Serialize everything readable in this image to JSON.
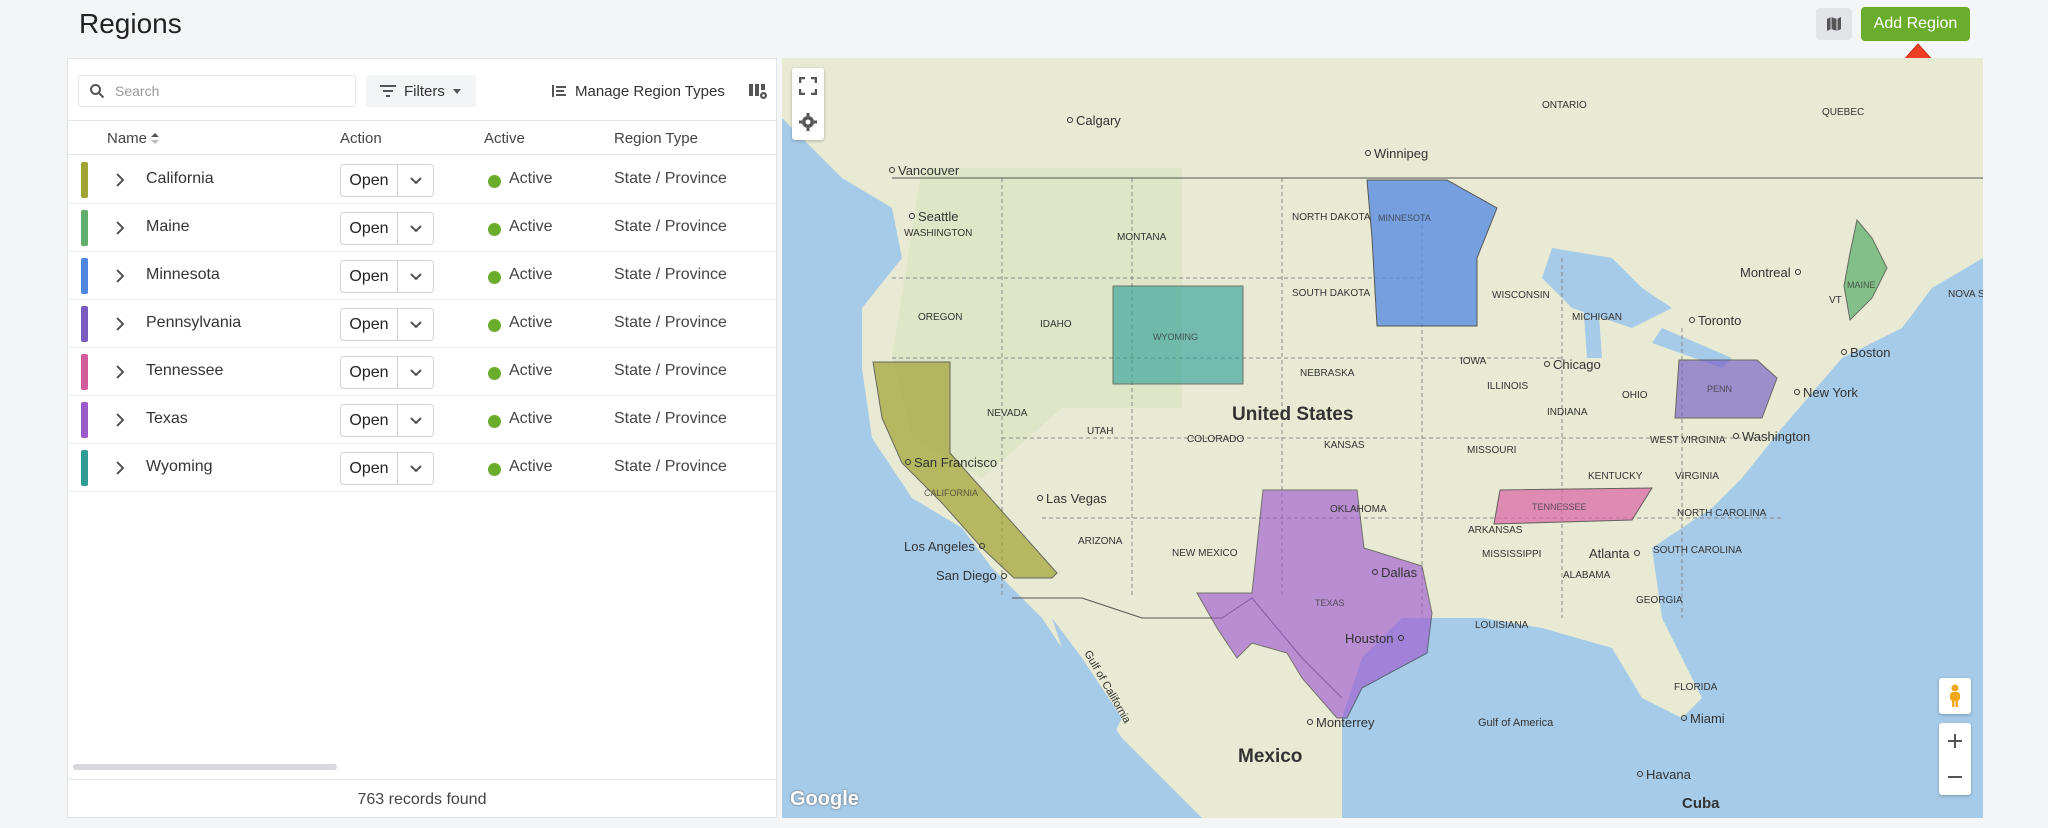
{
  "page": {
    "title": "Regions"
  },
  "header": {
    "add_region_label": "Add Region",
    "map_toggle_icon": "map-icon"
  },
  "toolbar": {
    "search_placeholder": "Search",
    "filters_label": "Filters",
    "manage_label": "Manage Region Types"
  },
  "table": {
    "columns": [
      "Name",
      "Action",
      "Active",
      "Region Type"
    ],
    "rows": [
      {
        "name": "California",
        "action": "Open",
        "active": "Active",
        "type": "State / Province",
        "color": "#9fa433"
      },
      {
        "name": "Maine",
        "action": "Open",
        "active": "Active",
        "type": "State / Province",
        "color": "#5fae6a"
      },
      {
        "name": "Minnesota",
        "action": "Open",
        "active": "Active",
        "type": "State / Province",
        "color": "#4f86e0"
      },
      {
        "name": "Pennsylvania",
        "action": "Open",
        "active": "Active",
        "type": "State / Province",
        "color": "#7a5cc1"
      },
      {
        "name": "Tennessee",
        "action": "Open",
        "active": "Active",
        "type": "State / Province",
        "color": "#d35c9c"
      },
      {
        "name": "Texas",
        "action": "Open",
        "active": "Active",
        "type": "State / Province",
        "color": "#9a5bc8"
      },
      {
        "name": "Wyoming",
        "action": "Open",
        "active": "Active",
        "type": "State / Province",
        "color": "#2f9b94"
      }
    ],
    "footer": "763 records found"
  },
  "map": {
    "country_labels": {
      "us": "United States",
      "mexico": "Mexico"
    },
    "city_labels": [
      "Calgary",
      "Winnipeg",
      "Vancouver",
      "Seattle",
      "Montreal",
      "Toronto",
      "Boston",
      "New York",
      "Chicago",
      "Washington",
      "San Francisco",
      "Las Vegas",
      "Los Angeles",
      "San Diego",
      "Dallas",
      "Houston",
      "Atlanta",
      "Monterrey",
      "Miami",
      "Havana",
      "Cuba"
    ],
    "state_labels": [
      "ONTARIO",
      "QUEBEC",
      "WASHINGTON",
      "MONTANA",
      "NORTH DAKOTA",
      "SOUTH DAKOTA",
      "OREGON",
      "IDAHO",
      "NEBRASKA",
      "IOWA",
      "WISCONSIN",
      "MICHIGAN",
      "ILLINOIS",
      "INDIANA",
      "OHIO",
      "NEVADA",
      "UTAH",
      "COLORADO",
      "KANSAS",
      "MISSOURI",
      "KENTUCKY",
      "VIRGINIA",
      "WEST VIRGINIA",
      "NORTH CAROLINA",
      "SOUTH CAROLINA",
      "ARIZONA",
      "NEW MEXICO",
      "OKLAHOMA",
      "ARKANSAS",
      "MISSISSIPPI",
      "ALABAMA",
      "GEORGIA",
      "LOUISIANA",
      "FLORIDA",
      "VT",
      "NOVA S"
    ],
    "water_labels": [
      "Gulf of California",
      "Gulf of America"
    ],
    "region_labels": [
      "MINNESOTA",
      "WYOMING",
      "MAINE",
      "PENN",
      "CALIFORNIA",
      "TENNESSEE",
      "TEXAS"
    ],
    "google": "Google"
  }
}
